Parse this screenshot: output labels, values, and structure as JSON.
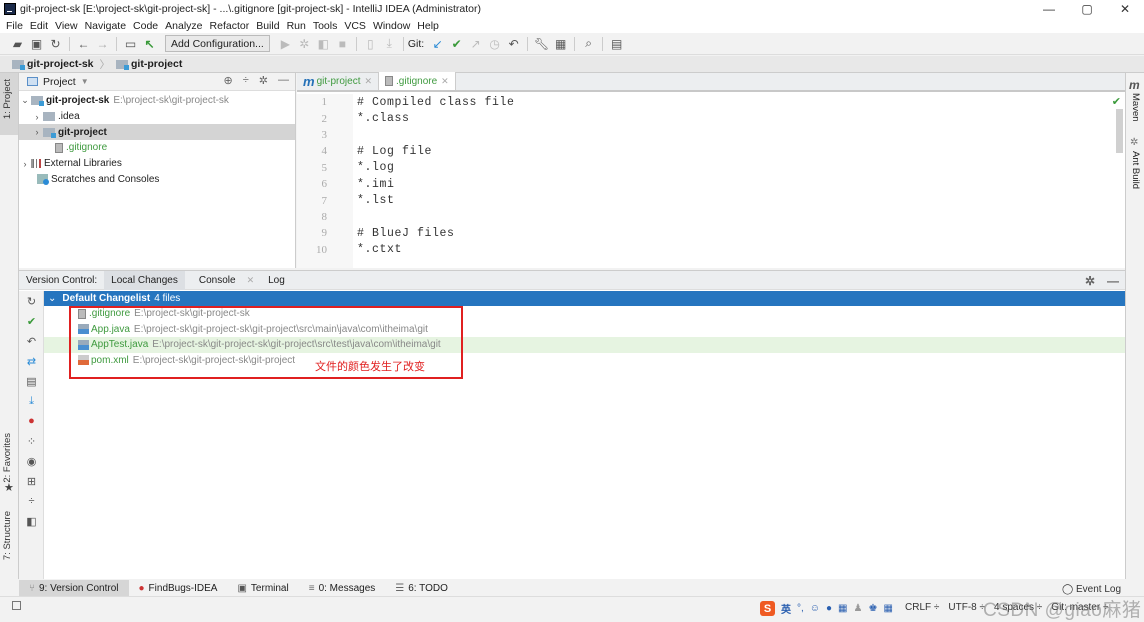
{
  "window": {
    "title": "git-project-sk [E:\\project-sk\\git-project-sk] - ...\\.gitignore [git-project-sk] - IntelliJ IDEA (Administrator)",
    "controls": {
      "minimize": "—",
      "restore": "▢",
      "close": "✕"
    }
  },
  "menu": [
    "File",
    "Edit",
    "View",
    "Navigate",
    "Code",
    "Analyze",
    "Refactor",
    "Build",
    "Run",
    "Tools",
    "VCS",
    "Window",
    "Help"
  ],
  "toolbar": {
    "add_configuration": "Add Configuration...",
    "git_label": "Git:",
    "icons": [
      "open-folder-icon",
      "save-icon",
      "sync-icon",
      "back-icon",
      "forward-icon",
      "terminal-frame-icon",
      "build-hammer-icon",
      "run-icon",
      "debug-icon",
      "coverage-icon",
      "stop-icon",
      "bookmark-icon",
      "download-icon",
      "git-update-icon",
      "git-commit-icon",
      "git-push-icon",
      "history-icon",
      "rollback-icon",
      "settings-wrench-icon",
      "project-structure-icon",
      "search-icon",
      "vcs-operations-icon"
    ]
  },
  "breadcrumb": [
    "git-project-sk",
    "git-project"
  ],
  "left_strip": {
    "project": "1: Project",
    "favorites": "2: Favorites",
    "structure": "7: Structure"
  },
  "right_strip": {
    "maven": "Maven",
    "ant": "Ant Build"
  },
  "project_panel": {
    "title": "Project",
    "tree": [
      {
        "name": "git-project-sk",
        "path": "E:\\project-sk\\git-project-sk",
        "bold": true,
        "expanded": true
      },
      {
        "name": ".idea"
      },
      {
        "name": "git-project",
        "bold": true,
        "selected": true
      },
      {
        "name": ".gitignore",
        "status": "added"
      },
      {
        "name": "External Libraries"
      },
      {
        "name": "Scratches and Consoles"
      }
    ]
  },
  "editor": {
    "tabs": [
      {
        "label": "git-project",
        "active": false
      },
      {
        "label": ".gitignore",
        "active": true
      }
    ],
    "lines": [
      {
        "n": "1",
        "text": "# Compiled class file"
      },
      {
        "n": "2",
        "text": "*.class"
      },
      {
        "n": "3",
        "text": ""
      },
      {
        "n": "4",
        "text": "# Log file"
      },
      {
        "n": "5",
        "text": "*.log"
      },
      {
        "n": "6",
        "text": "*.imi"
      },
      {
        "n": "7",
        "text": "*.lst"
      },
      {
        "n": "8",
        "text": ""
      },
      {
        "n": "9",
        "text": "# BlueJ files"
      },
      {
        "n": "10",
        "text": "*.ctxt"
      }
    ]
  },
  "version_control": {
    "label": "Version Control:",
    "tabs": [
      "Local Changes",
      "Console",
      "Log"
    ],
    "changelist": {
      "name": "Default Changelist",
      "count": "4 files"
    },
    "files": [
      {
        "name": ".gitignore",
        "path": "E:\\project-sk\\git-project-sk"
      },
      {
        "name": "App.java",
        "path": "E:\\project-sk\\git-project-sk\\git-project\\src\\main\\java\\com\\itheima\\git"
      },
      {
        "name": "AppTest.java",
        "path": "E:\\project-sk\\git-project-sk\\git-project\\src\\test\\java\\com\\itheima\\git"
      },
      {
        "name": "pom.xml",
        "path": "E:\\project-sk\\git-project-sk\\git-project"
      }
    ],
    "annotation": "文件的颜色发生了改变"
  },
  "bottom_tabs": [
    "9: Version Control",
    "FindBugs-IDEA",
    "Terminal",
    "0: Messages",
    "6: TODO"
  ],
  "status": {
    "event_log": "Event Log",
    "line_sep": "CRLF ÷",
    "encoding": "UTF-8 ÷",
    "indent": "4 spaces ÷",
    "branch": "Git: master ÷",
    "ime": "英",
    "watermark": "CSDN @giao麻猪"
  },
  "colors": {
    "accent": "#2675bf",
    "added": "#3f9a3f",
    "annotation": "#e02020"
  }
}
